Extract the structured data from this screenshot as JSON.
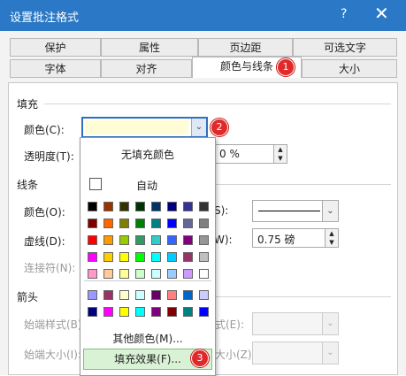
{
  "window": {
    "title": "设置批注格式",
    "help": "?",
    "close": "✕"
  },
  "tabs_row1": [
    "保护",
    "属性",
    "页边距",
    "可选文字"
  ],
  "tabs_row2": [
    "字体",
    "对齐",
    "颜色与线条",
    "大小"
  ],
  "fill": {
    "section": "填充",
    "color_label": "颜色(C):",
    "color_value": "#fffcd6",
    "transparency_label": "透明度(T):",
    "transparency_value": "0 %"
  },
  "line": {
    "section": "线条",
    "color_label": "颜色(O):",
    "dash_label": "虚线(D):",
    "connector_label": "连接符(N):",
    "style_label_fragment": "S):",
    "weight_label_fragment": "W):",
    "weight_value": "0.75 磅"
  },
  "arrows": {
    "section": "箭头",
    "begin_style": "始端样式(B)",
    "begin_size": "始端大小(I):",
    "end_style_fragment": "式(E):",
    "end_size_fragment": "大小(Z):"
  },
  "popup": {
    "no_fill": "无填充颜色",
    "auto": "自动",
    "more_colors": "其他颜色(M)...",
    "fill_effects": "填充效果(F)...",
    "grid_colors": [
      [
        "#000000",
        "#993300",
        "#333300",
        "#003300",
        "#003366",
        "#000080",
        "#333399",
        "#333333"
      ],
      [
        "#800000",
        "#ff6600",
        "#808000",
        "#008000",
        "#008080",
        "#0000ff",
        "#666699",
        "#808080"
      ],
      [
        "#ff0000",
        "#ff9900",
        "#99cc00",
        "#339966",
        "#33cccc",
        "#3366ff",
        "#800080",
        "#969696"
      ],
      [
        "#ff00ff",
        "#ffcc00",
        "#ffff00",
        "#00ff00",
        "#00ffff",
        "#00ccff",
        "#993366",
        "#c0c0c0"
      ],
      [
        "#ff99cc",
        "#ffcc99",
        "#ffff99",
        "#ccffcc",
        "#ccffff",
        "#99ccff",
        "#cc99ff",
        "#ffffff"
      ]
    ],
    "extra_colors": [
      [
        "#9999ff",
        "#993366",
        "#ffffcc",
        "#ccffff",
        "#660066",
        "#ff8080",
        "#0066cc",
        "#ccccff"
      ],
      [
        "#000080",
        "#ff00ff",
        "#ffff00",
        "#00ffff",
        "#800080",
        "#800000",
        "#008080",
        "#0000ff"
      ]
    ]
  },
  "badges": [
    "1",
    "2",
    "3"
  ]
}
